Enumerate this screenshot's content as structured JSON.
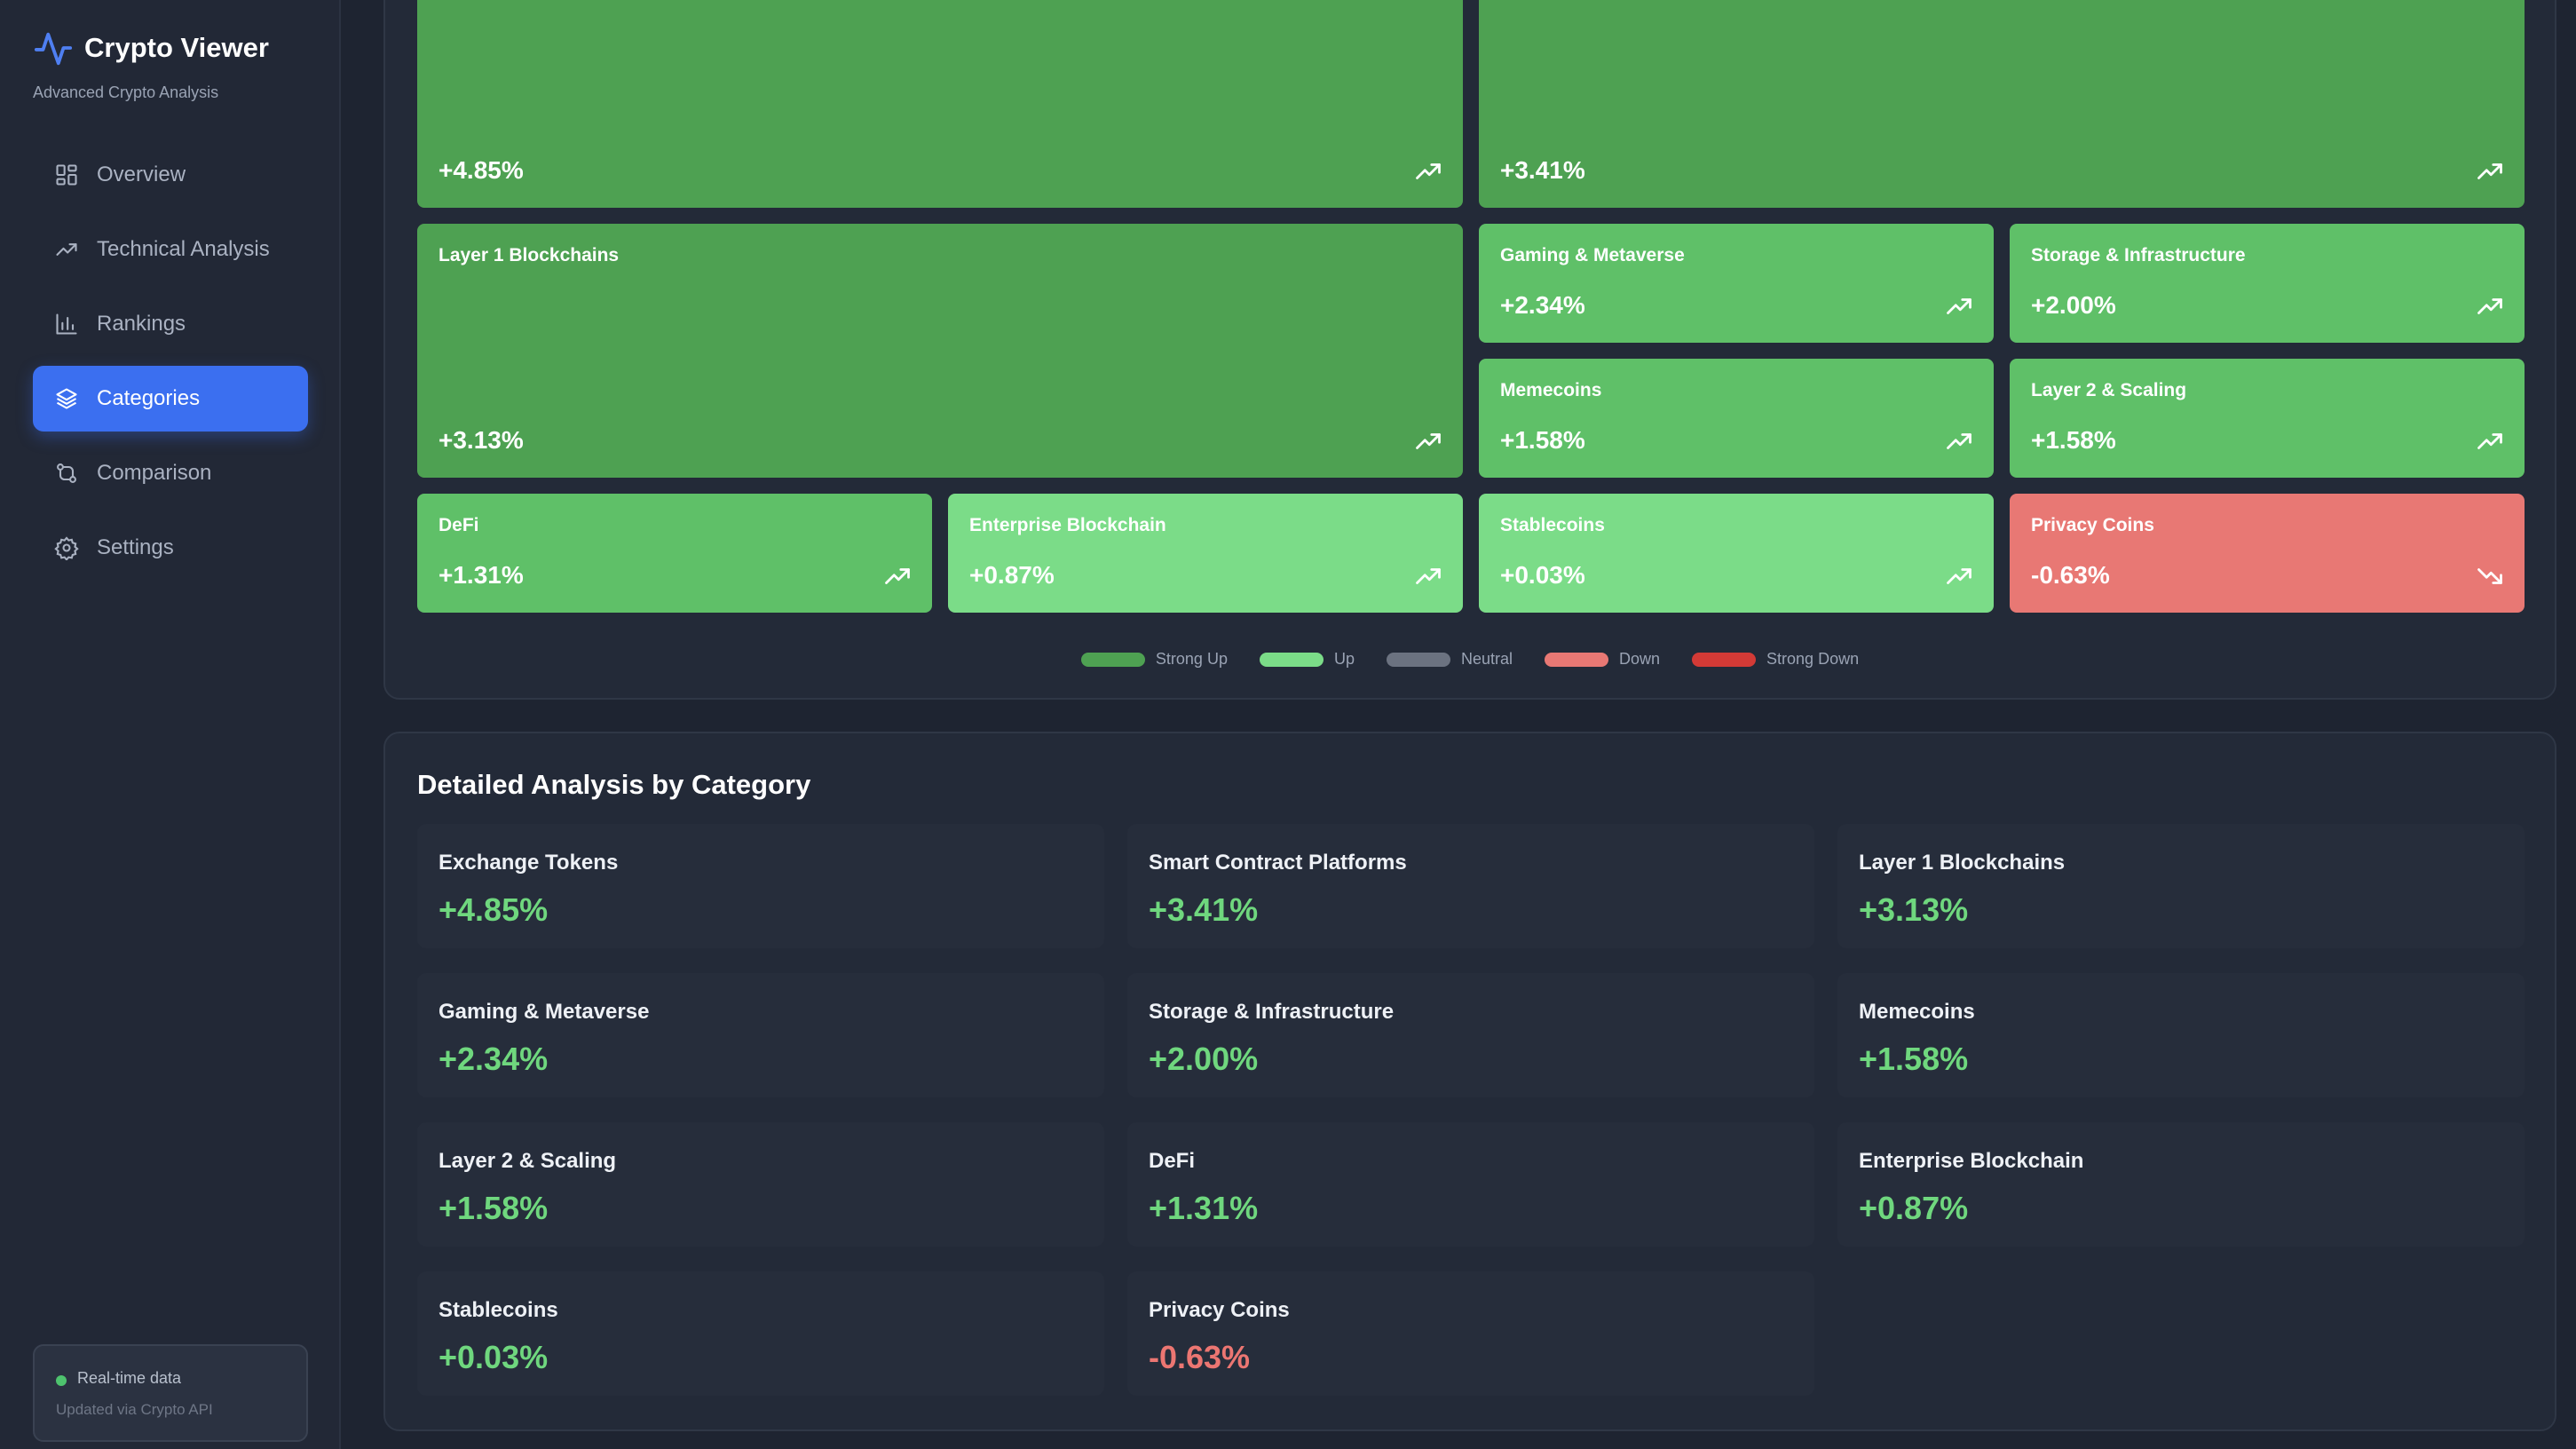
{
  "app": {
    "title": "Crypto Viewer",
    "subtitle": "Advanced Crypto Analysis"
  },
  "nav": [
    {
      "label": "Overview",
      "icon": "grid-icon"
    },
    {
      "label": "Technical Analysis",
      "icon": "trending-up-icon"
    },
    {
      "label": "Rankings",
      "icon": "bar-chart-icon"
    },
    {
      "label": "Categories",
      "icon": "layers-icon",
      "active": true
    },
    {
      "label": "Comparison",
      "icon": "git-compare-icon"
    },
    {
      "label": "Settings",
      "icon": "gear-icon"
    }
  ],
  "status": {
    "title": "Real-time data",
    "subtitle": "Updated via Crypto API"
  },
  "heatmap": {
    "tiles": [
      {
        "name": "",
        "value": "+4.85%",
        "trend": "up"
      },
      {
        "name": "",
        "value": "+3.41%",
        "trend": "up"
      },
      {
        "name": "Layer 1 Blockchains",
        "value": "+3.13%",
        "trend": "up"
      },
      {
        "name": "Gaming & Metaverse",
        "value": "+2.34%",
        "trend": "up"
      },
      {
        "name": "Storage & Infrastructure",
        "value": "+2.00%",
        "trend": "up"
      },
      {
        "name": "Memecoins",
        "value": "+1.58%",
        "trend": "up"
      },
      {
        "name": "Layer 2 & Scaling",
        "value": "+1.58%",
        "trend": "up"
      },
      {
        "name": "DeFi",
        "value": "+1.31%",
        "trend": "up"
      },
      {
        "name": "Enterprise Blockchain",
        "value": "+0.87%",
        "trend": "up"
      },
      {
        "name": "Stablecoins",
        "value": "+0.03%",
        "trend": "up"
      },
      {
        "name": "Privacy Coins",
        "value": "-0.63%",
        "trend": "down"
      }
    ],
    "legend": [
      {
        "label": "Strong Up",
        "color": "#4ea152"
      },
      {
        "label": "Up",
        "color": "#7bdc88"
      },
      {
        "label": "Neutral",
        "color": "#6b7280"
      },
      {
        "label": "Down",
        "color": "#e87874"
      },
      {
        "label": "Strong Down",
        "color": "#d33a36"
      }
    ]
  },
  "detail": {
    "title": "Detailed Analysis by Category",
    "cards": [
      {
        "name": "Exchange Tokens",
        "value": "+4.85%"
      },
      {
        "name": "Smart Contract Platforms",
        "value": "+3.41%"
      },
      {
        "name": "Layer 1 Blockchains",
        "value": "+3.13%"
      },
      {
        "name": "Gaming & Metaverse",
        "value": "+2.34%"
      },
      {
        "name": "Storage & Infrastructure",
        "value": "+2.00%"
      },
      {
        "name": "Memecoins",
        "value": "+1.58%"
      },
      {
        "name": "Layer 2 & Scaling",
        "value": "+1.58%"
      },
      {
        "name": "DeFi",
        "value": "+1.31%"
      },
      {
        "name": "Enterprise Blockchain",
        "value": "+0.87%"
      },
      {
        "name": "Stablecoins",
        "value": "+0.03%"
      },
      {
        "name": "Privacy Coins",
        "value": "-0.63%"
      }
    ]
  }
}
